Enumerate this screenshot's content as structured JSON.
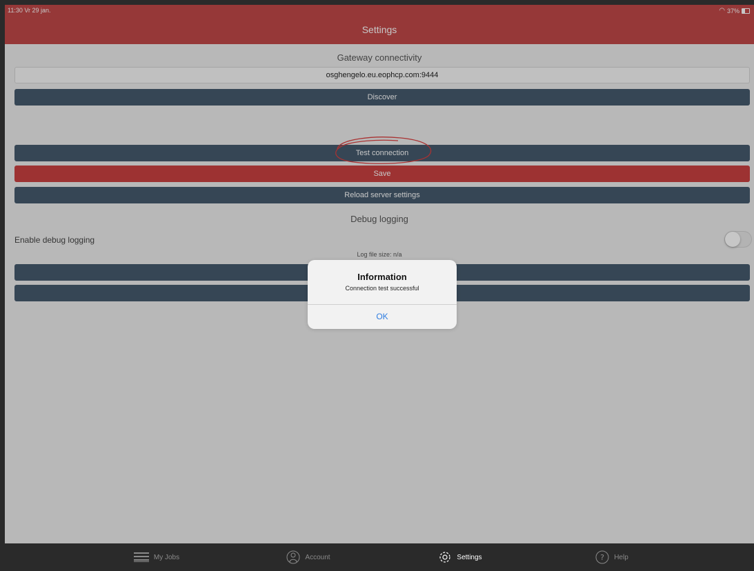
{
  "status_bar": {
    "time_date": "11:30  Vr 29 jan.",
    "battery": "37%",
    "battery_level": 0.37
  },
  "header": {
    "title": "Settings"
  },
  "gateway": {
    "section_title": "Gateway connectivity",
    "url_value": "osghengelo.eu.eophcp.com:9444",
    "discover_label": "Discover",
    "test_connection_label": "Test connection",
    "save_label": "Save",
    "reload_label": "Reload server settings"
  },
  "debug": {
    "section_title": "Debug logging",
    "enable_label": "Enable debug logging",
    "enabled": false,
    "log_file_size": "Log file size:  n/a"
  },
  "alert": {
    "title": "Information",
    "message": "Connection test successful",
    "ok_label": "OK"
  },
  "tabs": [
    {
      "label": "My Jobs",
      "icon": "list-icon"
    },
    {
      "label": "Account",
      "icon": "person-icon"
    },
    {
      "label": "Settings",
      "icon": "gear-icon"
    },
    {
      "label": "Help",
      "icon": "help-icon"
    }
  ],
  "active_tab": "Settings",
  "colors": {
    "header": "#c14848",
    "button_dark": "#465a6d",
    "button_red": "#c94141",
    "annotation": "#d94040",
    "link_blue": "#2f7de1"
  }
}
